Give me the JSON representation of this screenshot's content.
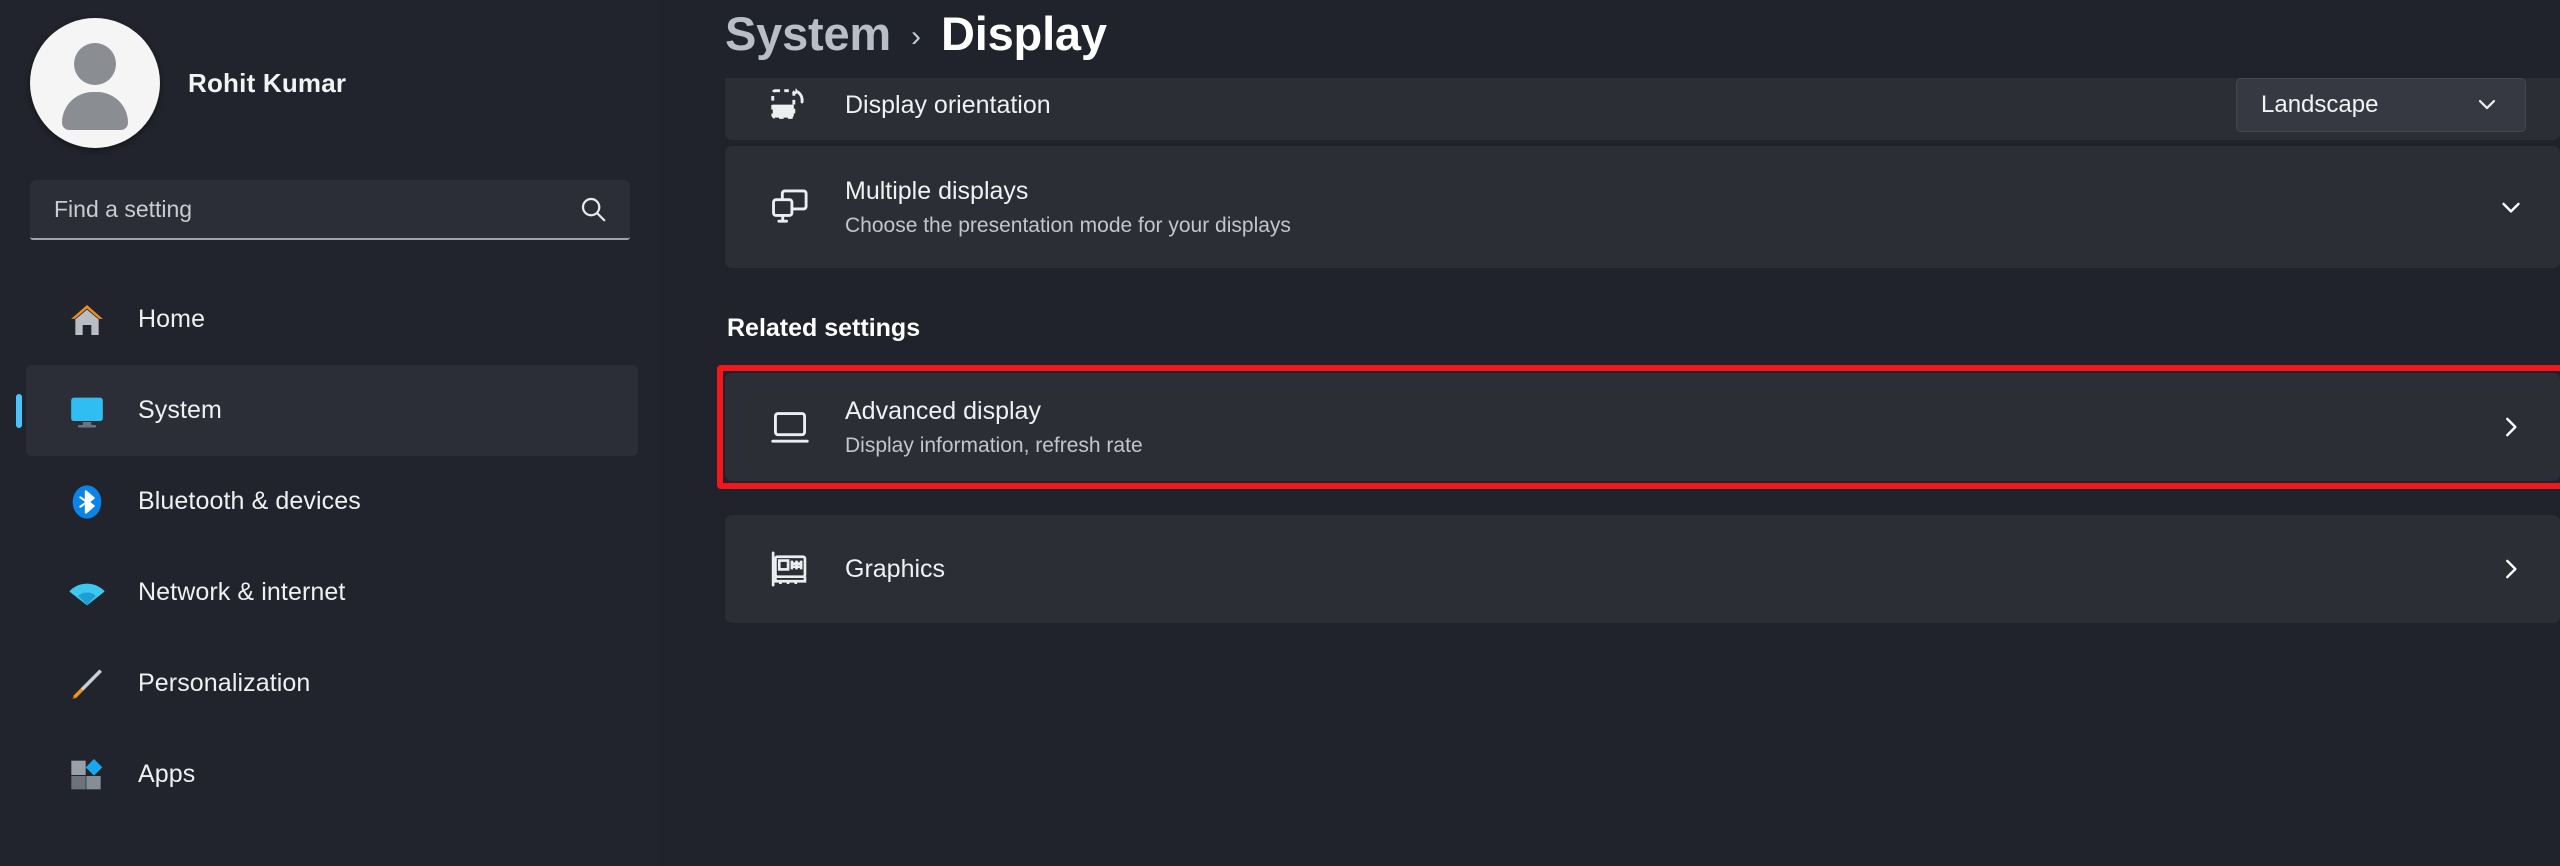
{
  "app": {
    "name": "Settings",
    "theme": "dark"
  },
  "colors": {
    "background": "#20232b",
    "card": "#2b2e35",
    "accent": "#4cc2ff",
    "annotation": "#f5161b",
    "text_primary": "#f0f1f3",
    "text_secondary": "#c2c6cc"
  },
  "sidebar": {
    "profile": {
      "name": "Rohit Kumar",
      "avatar_icon": "user-avatar-icon"
    },
    "search": {
      "placeholder": "Find a setting",
      "value": "",
      "icon": "search-icon"
    },
    "items": [
      {
        "label": "Home",
        "icon": "home-icon",
        "selected": false
      },
      {
        "label": "System",
        "icon": "system-monitor-icon",
        "selected": true
      },
      {
        "label": "Bluetooth & devices",
        "icon": "bluetooth-icon",
        "selected": false
      },
      {
        "label": "Network & internet",
        "icon": "wifi-icon",
        "selected": false
      },
      {
        "label": "Personalization",
        "icon": "paintbrush-icon",
        "selected": false
      },
      {
        "label": "Apps",
        "icon": "apps-icon",
        "selected": false
      }
    ]
  },
  "header": {
    "breadcrumb_root": "System",
    "breadcrumb_separator": "›",
    "breadcrumb_current": "Display"
  },
  "main": {
    "rows": [
      {
        "title": "Display orientation",
        "subtitle": "",
        "icon": "screen-rotation-icon",
        "control": "dropdown",
        "dropdown_value": "Landscape",
        "clipped": true
      },
      {
        "title": "Multiple displays",
        "subtitle": "Choose the presentation mode for your displays",
        "icon": "multiple-displays-icon",
        "control": "expander",
        "chevron": "chevron-down"
      }
    ],
    "related_settings_heading": "Related settings",
    "related_rows": [
      {
        "title": "Advanced display",
        "subtitle": "Display information, refresh rate",
        "icon": "monitor-icon",
        "control": "navigate",
        "chevron": "chevron-right",
        "highlighted": true
      },
      {
        "title": "Graphics",
        "subtitle": "",
        "icon": "graphics-card-icon",
        "control": "navigate",
        "chevron": "chevron-right",
        "highlighted": false
      }
    ]
  }
}
